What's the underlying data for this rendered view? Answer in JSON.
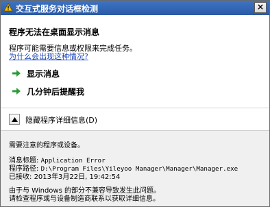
{
  "window": {
    "title": "交互式服务对话框检测",
    "close_label": "×"
  },
  "main": {
    "heading": "程序无法在桌面显示消息",
    "subtext": "程序可能需要信息或权限来完成任务。",
    "link": "为什么会出现这种情况?"
  },
  "actions": [
    {
      "label": "显示消息",
      "icon": "green-arrow-icon"
    },
    {
      "label": "几分钟后提醒我",
      "icon": "green-arrow-icon"
    }
  ],
  "details_toggle": {
    "label": "隐藏程序详细信息(D)",
    "icon": "up-triangle-icon"
  },
  "details": {
    "notice": "需要注意的程序或设备。",
    "message_title_label": "消息标题:",
    "message_title_value": "Application Error",
    "program_path_label": "程序路径:",
    "program_path_value": "D:\\Program Files\\Yileyoo Manager\\Manager\\Manager.exe",
    "received_label": "已接收:",
    "received_value": "2013年3月22日, 19:42:54",
    "note_line1": "由于与 Windows 的部分不兼容导致发生此问题。",
    "note_line2": "请检查程序或与设备制造商联系以获取详细信息。"
  },
  "colors": {
    "title_bar": "#2f62b2",
    "link": "#1e47b6",
    "arrow": "#2e9a3a",
    "details_bg": "#f0f0f0"
  }
}
